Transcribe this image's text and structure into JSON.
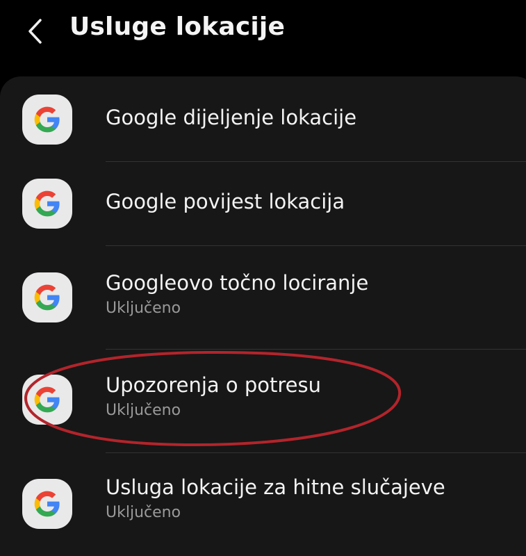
{
  "header": {
    "back_icon": "chevron-left-icon",
    "title": "Usluge lokacije"
  },
  "items": [
    {
      "icon": "google-g-icon",
      "title": "Google dijeljenje lokacije",
      "subtitle": ""
    },
    {
      "icon": "google-g-icon",
      "title": "Google povijest lokacija",
      "subtitle": ""
    },
    {
      "icon": "google-g-icon",
      "title": "Googleovo točno lociranje",
      "subtitle": "Uključeno"
    },
    {
      "icon": "google-g-icon",
      "title": "Upozorenja o potresu",
      "subtitle": "Uključeno"
    },
    {
      "icon": "google-g-icon",
      "title": "Usluga lokacije za hitne slučajeve",
      "subtitle": "Uključeno"
    }
  ],
  "annotation": {
    "shape": "hand-drawn ellipse",
    "highlights": "Upozorenja o potresu",
    "color": "#b3242b"
  },
  "colors": {
    "background": "#000000",
    "card": "#171717",
    "text_primary": "#f3f3f3",
    "text_secondary": "#9a9a9a",
    "icon_bg": "#e9e9e9",
    "google_blue": "#4285F4",
    "google_red": "#EA4335",
    "google_yellow": "#FBBC05",
    "google_green": "#34A853"
  }
}
